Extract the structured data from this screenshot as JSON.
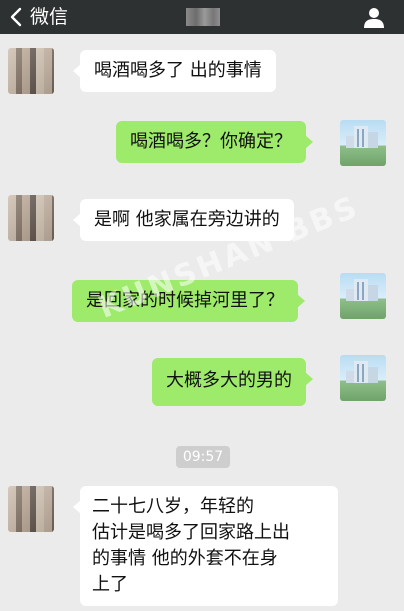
{
  "header": {
    "back_label": "微信",
    "title": ""
  },
  "messages": [
    {
      "side": "left",
      "text": "喝酒喝多了 出的事情"
    },
    {
      "side": "right",
      "text": "喝酒喝多？你确定？"
    },
    {
      "side": "left",
      "text": "是啊  他家属在旁边讲的"
    },
    {
      "side": "right",
      "text": "是回家的时候掉河里了？"
    },
    {
      "side": "right",
      "text": "大概多大的男的"
    },
    {
      "side": "left",
      "lines": [
        "二十七八岁，年轻的",
        " 估计是喝多了回家路上出",
        "的事情  他的外套不在身",
        "上了"
      ]
    }
  ],
  "timestamp": "09:57",
  "watermark": "KUNSHAN BBS",
  "colors": {
    "topbar": "#2e3132",
    "background": "#ebebeb",
    "bubble_left": "#ffffff",
    "bubble_right": "#9eea6a",
    "timestamp_bg": "#cecece"
  }
}
